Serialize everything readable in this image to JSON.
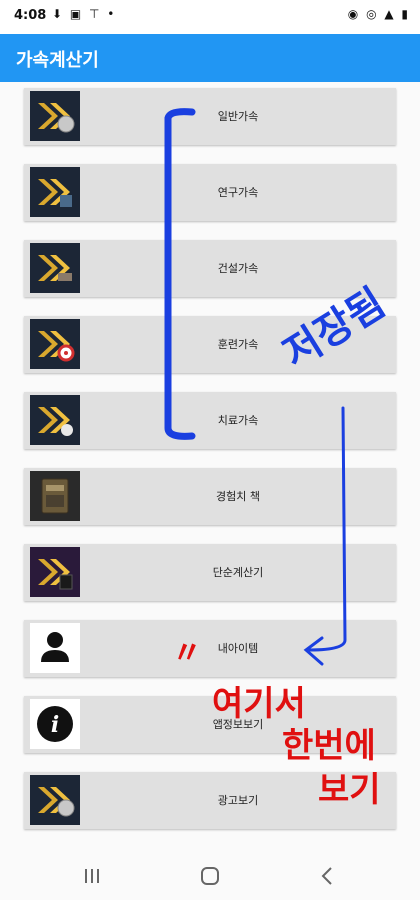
{
  "status_bar": {
    "time": "4:08",
    "left_icons": "⬇ ▣ ⊤ •",
    "right_icons": "◉ ◎ ▲ ▮"
  },
  "app_bar": {
    "title": "가속계산기"
  },
  "list_items": [
    {
      "label": "일반가속",
      "icon": "gold-speedup-icon"
    },
    {
      "label": "연구가속",
      "icon": "research-speedup-icon"
    },
    {
      "label": "건설가속",
      "icon": "construction-speedup-icon"
    },
    {
      "label": "훈련가속",
      "icon": "training-speedup-icon"
    },
    {
      "label": "치료가속",
      "icon": "healing-speedup-icon"
    },
    {
      "label": "경험치 책",
      "icon": "xp-book-icon"
    },
    {
      "label": "단순계산기",
      "icon": "calculator-speedup-icon"
    },
    {
      "label": "내아이템",
      "icon": "person-icon"
    },
    {
      "label": "앱정보보기",
      "icon": "info-icon"
    },
    {
      "label": "광고보기",
      "icon": "ad-speedup-icon"
    }
  ],
  "annotations": {
    "blue_text": "저장됨",
    "red_text_line1": "여기서",
    "red_text_line2": "한번에",
    "red_text_line3": "보기",
    "red_marks": "〃",
    "blue_color": "#1a3fe0",
    "red_color": "#e01010"
  },
  "colors": {
    "app_bar": "#2196f3",
    "item_bg": "#e0e0e0"
  },
  "nav_bar": {
    "recent": "recent-apps-icon",
    "home": "home-icon",
    "back": "back-icon"
  }
}
